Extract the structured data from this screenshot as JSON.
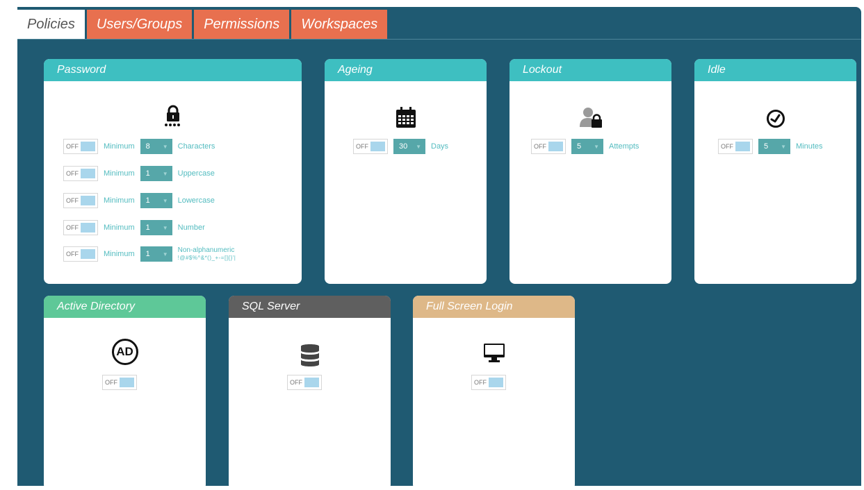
{
  "tabs": [
    {
      "label": "Policies",
      "active": true
    },
    {
      "label": "Users/Groups",
      "active": false
    },
    {
      "label": "Permissions",
      "active": false
    },
    {
      "label": "Workspaces",
      "active": false
    }
  ],
  "toggle_text": "OFF",
  "password": {
    "title": "Password",
    "rows": [
      {
        "prefix": "Minimum",
        "value": "8",
        "suffix": "Characters"
      },
      {
        "prefix": "Minimum",
        "value": "1",
        "suffix": "Uppercase"
      },
      {
        "prefix": "Minimum",
        "value": "1",
        "suffix": "Lowercase"
      },
      {
        "prefix": "Minimum",
        "value": "1",
        "suffix": "Number"
      },
      {
        "prefix": "Minimum",
        "value": "1",
        "suffix": "Non-alphanumeric",
        "suffix2": "!@#$%^&*()_+-=[]{}'|"
      }
    ]
  },
  "ageing": {
    "title": "Ageing",
    "value": "30",
    "suffix": "Days"
  },
  "lockout": {
    "title": "Lockout",
    "value": "5",
    "suffix": "Attempts"
  },
  "idle": {
    "title": "Idle",
    "value": "5",
    "suffix": "Minutes"
  },
  "active_directory": {
    "title": "Active Directory",
    "icon_text": "AD"
  },
  "sql_server": {
    "title": "SQL Server"
  },
  "full_screen_login": {
    "title": "Full Screen Login"
  },
  "colors": {
    "background": "#1f5a72",
    "tab_inactive": "#e8704f",
    "card_head_teal": "#3ebfc1",
    "card_head_green": "#5ec898",
    "card_head_grey": "#5f5f5f",
    "card_head_tan": "#deb888",
    "select_bg": "#56a7a9",
    "toggle_knob": "#a9d6ec"
  }
}
